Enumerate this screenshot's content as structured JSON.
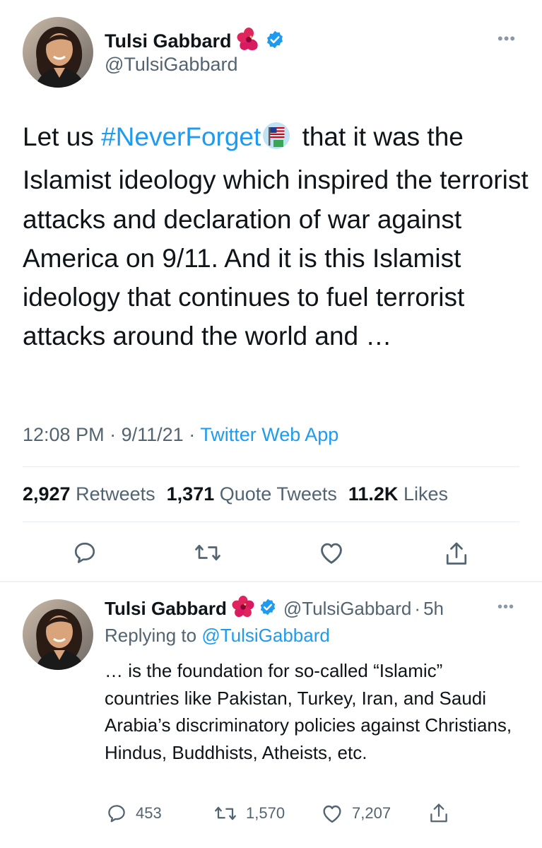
{
  "main_tweet": {
    "author_name": "Tulsi Gabbard",
    "author_handle": "@TulsiGabbard",
    "text_before_hashtag": "Let us ",
    "hashtag": "#NeverForget",
    "text_after_hashtag": " that it was the Islamist ideology which inspired the terrorist attacks and declaration of war against America on 9/11. And it is this Islamist ideology that continues to fuel terrorist attacks around the world and …",
    "time": "12:08 PM",
    "date": "9/11/21",
    "separator": "·",
    "source_app": "Twitter Web App",
    "stats": {
      "retweets_count": "2,927",
      "retweets_label": "Retweets",
      "quotes_count": "1,371",
      "quotes_label": "Quote Tweets",
      "likes_count": "11.2K",
      "likes_label": "Likes"
    },
    "more_glyph": "•••"
  },
  "reply_tweet": {
    "author_name": "Tulsi Gabbard",
    "author_handle": "@TulsiGabbard",
    "separator": "·",
    "age": "5h",
    "replying_prefix": "Replying to ",
    "replying_to": "@TulsiGabbard",
    "text": "… is the foundation for so-called “Islamic” countries like Pakistan, Turkey, Iran, and Saudi Arabia’s discriminatory policies against Christians, Hindus, Buddhists, Atheists, etc.",
    "reply_count": "453",
    "retweet_count": "1,570",
    "like_count": "7,207",
    "more_glyph": "•••"
  },
  "icons": {
    "flower": "hibiscus-icon",
    "verified": "verified-badge-icon",
    "hashtag_emoji": "never-forget-flag-icon",
    "reply": "reply-icon",
    "retweet": "retweet-icon",
    "like": "heart-icon",
    "share": "share-icon"
  },
  "colors": {
    "link": "#1d9bf0",
    "secondary_text": "#536471",
    "primary_text": "#0f1419",
    "verified": "#1d9bf0",
    "flower": "#d81b60"
  }
}
